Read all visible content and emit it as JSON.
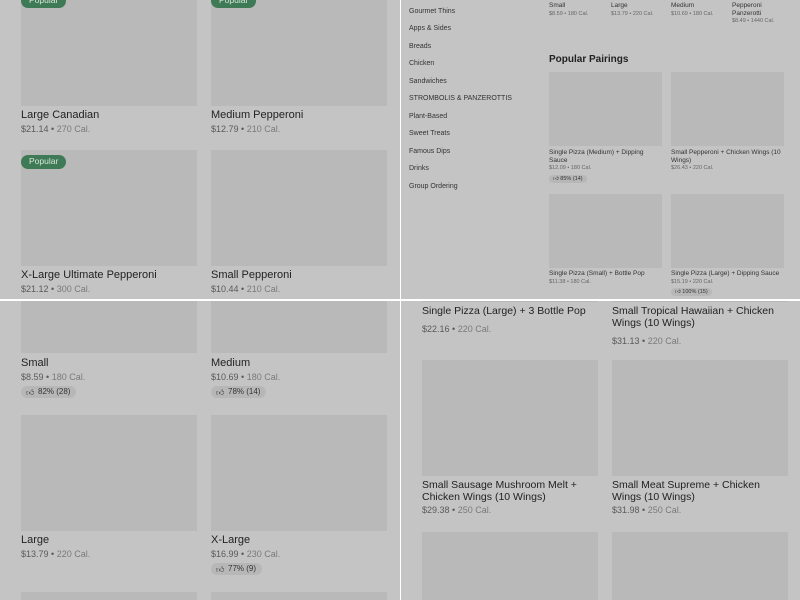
{
  "q1": {
    "cards": [
      {
        "badge": "Popular",
        "name": "Large Canadian",
        "price": "$21.14",
        "cal": "270 Cal."
      },
      {
        "badge": "Popular",
        "name": "Medium Pepperoni",
        "price": "$12.79",
        "cal": "210 Cal."
      },
      {
        "badge": "Popular",
        "name": "X-Large Ultimate Pepperoni",
        "price": "$21.12",
        "cal": "300 Cal."
      },
      {
        "badge": "",
        "name": "Small Pepperoni",
        "price": "$10.44",
        "cal": "210 Cal."
      }
    ]
  },
  "q2": {
    "menu": [
      "Gourmet Thins",
      "Apps & Sides",
      "Breads",
      "Chicken",
      "Sandwiches",
      "STROMBOLIS & PANZEROTTIS",
      "Plant-Based",
      "Sweet Treats",
      "Famous Dips",
      "Drinks",
      "Group Ordering"
    ],
    "top_row": [
      {
        "name": "Small",
        "price": "$8.59",
        "cal": "180 Cal."
      },
      {
        "name": "Large",
        "price": "$13.79",
        "cal": "220 Cal."
      },
      {
        "name": "Medium",
        "price": "$10.69",
        "cal": "180 Cal."
      },
      {
        "name": "Pepperoni Panzerotti",
        "price": "$8.49",
        "cal": "1440 Cal."
      }
    ],
    "section_title": "Popular Pairings",
    "pairings": [
      {
        "name": "Single Pizza (Medium) + Dipping Sauce",
        "price": "$12.09",
        "cal": "180 Cal.",
        "rating": "85% (14)"
      },
      {
        "name": "Small Pepperoni + Chicken Wings (10 Wings)",
        "price": "$26.43",
        "cal": "220 Cal.",
        "rating": ""
      },
      {
        "name": "Single Pizza (Small) + Bottle Pop",
        "price": "$11.38",
        "cal": "180 Cal.",
        "rating": ""
      },
      {
        "name": "Single Pizza (Large) + Dipping Sauce",
        "price": "$15.19",
        "cal": "220 Cal.",
        "rating": "100% (15)"
      }
    ]
  },
  "q3": {
    "cards": [
      {
        "name": "Small",
        "price": "$8.59",
        "cal": "180 Cal.",
        "rating": "82% (28)"
      },
      {
        "name": "Medium",
        "price": "$10.69",
        "cal": "180 Cal.",
        "rating": "78% (14)"
      },
      {
        "name": "Large",
        "price": "$13.79",
        "cal": "220 Cal.",
        "rating": ""
      },
      {
        "name": "X-Large",
        "price": "$16.99",
        "cal": "230 Cal.",
        "rating": "77% (9)"
      }
    ]
  },
  "q4": {
    "cards": [
      {
        "name": "Single Pizza (Large) + 3 Bottle Pop",
        "price": "$22.16",
        "cal": "220 Cal."
      },
      {
        "name": "Small Tropical Hawaiian + Chicken Wings (10 Wings)",
        "price": "$31.13",
        "cal": "220 Cal."
      },
      {
        "name": "Small Sausage Mushroom Melt + Chicken Wings (10 Wings)",
        "price": "$29.38",
        "cal": "250 Cal."
      },
      {
        "name": "Small Meat Supreme + Chicken Wings (10 Wings)",
        "price": "$31.98",
        "cal": "250 Cal."
      }
    ]
  },
  "meta_separator": "•",
  "colors": {
    "badge": "#3f7a56",
    "overlay": "#c4c4c4"
  }
}
